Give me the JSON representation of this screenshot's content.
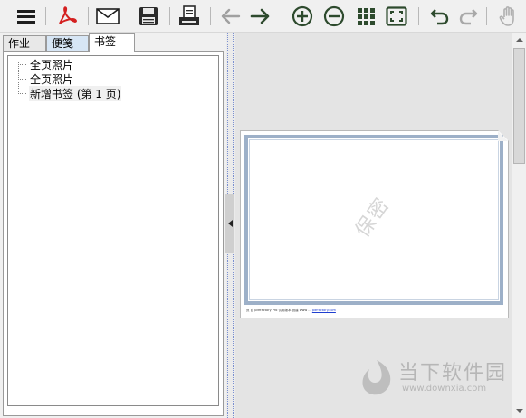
{
  "toolbar": {
    "buttons": [
      {
        "name": "menu-icon"
      },
      {
        "name": "pdf-icon"
      },
      {
        "name": "mail-icon"
      },
      {
        "name": "save-icon"
      },
      {
        "name": "print-icon"
      },
      {
        "name": "back-arrow-icon"
      },
      {
        "name": "forward-arrow-icon"
      },
      {
        "name": "zoom-in-icon"
      },
      {
        "name": "zoom-out-icon"
      },
      {
        "name": "grid-icon"
      },
      {
        "name": "fit-screen-icon"
      },
      {
        "name": "undo-icon"
      },
      {
        "name": "redo-icon"
      },
      {
        "name": "hand-icon"
      }
    ]
  },
  "tabs": [
    {
      "label": "作业",
      "active": false
    },
    {
      "label": "便笺",
      "active": false
    },
    {
      "label": "书签",
      "active": true
    }
  ],
  "tree": {
    "items": [
      {
        "label": "全页照片",
        "selected": false
      },
      {
        "label": "全页照片",
        "selected": false
      },
      {
        "label": "新增书签 (第 1 页)",
        "selected": true
      }
    ]
  },
  "preview": {
    "watermark": "保密",
    "footer_text": "页 自 pdfFactory Pro 试用版本 创建 www ... ",
    "footer_link": "pdffactory.com"
  },
  "site_watermark": {
    "name": "当下软件园",
    "url": "www.downxia.com"
  },
  "colors": {
    "frame_border": "#9db0c8",
    "toolbar_icon": "#2d4a2d",
    "pdf_red": "#d42020"
  }
}
